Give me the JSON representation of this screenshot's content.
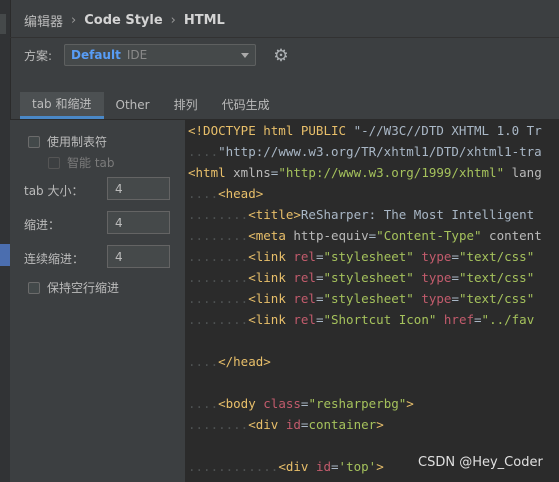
{
  "breadcrumb": {
    "item1": "编辑器",
    "item2": "Code Style",
    "item3": "HTML",
    "sep": "›"
  },
  "scheme": {
    "label": "方案:",
    "name": "Default",
    "tag": "IDE"
  },
  "tabs": [
    "tab 和缩进",
    "Other",
    "排列",
    "代码生成"
  ],
  "options": {
    "use_tab": "使用制表符",
    "smart_tab": "智能 tab",
    "tab_size_label": "tab 大小：",
    "tab_size": "4",
    "indent_label": "缩进：",
    "indent": "4",
    "continuation_label": "连续缩进：",
    "continuation": "4",
    "keep_indent": "保持空行缩进"
  },
  "code": {
    "l1": {
      "a": "<!DOCTYPE html PUBLIC ",
      "b": "\"-//W3C//DTD XHTML 1.0 Tr"
    },
    "l2": {
      "ws": "....",
      "a": "\"http://www.w3.org/TR/xhtml1/DTD/xhtml1-tra"
    },
    "l3": {
      "a": "<html ",
      "b": "xmlns",
      "c": "=",
      "d": "\"http://www.w3.org/1999/xhtml\"",
      "e": " lang"
    },
    "l4": {
      "ws": "....",
      "a": "<head>"
    },
    "l5": {
      "ws": "........",
      "a": "<title>",
      "b": "ReSharper: The Most Intelligent"
    },
    "l6": {
      "ws": "........",
      "a": "<meta ",
      "b": "http-equiv",
      "c": "=",
      "d": "\"Content-Type\"",
      "e": " content"
    },
    "l7": {
      "ws": "........",
      "a": "<link ",
      "b": "rel",
      "c": "=",
      "d": "\"stylesheet\"",
      "e": " type",
      "f": "=",
      "g": "\"text/css\""
    },
    "l8": {
      "ws": "........",
      "a": "<link ",
      "b": "rel",
      "c": "=",
      "d": "\"stylesheet\"",
      "e": " type",
      "f": "=",
      "g": "\"text/css\""
    },
    "l9": {
      "ws": "........",
      "a": "<link ",
      "b": "rel",
      "c": "=",
      "d": "\"stylesheet\"",
      "e": " type",
      "f": "=",
      "g": "\"text/css\""
    },
    "l10": {
      "ws": "........",
      "a": "<link ",
      "b": "rel",
      "c": "=",
      "d": "\"Shortcut Icon\"",
      "e": " href",
      "f": "=",
      "g": "\"../fav"
    },
    "l12": {
      "ws": "....",
      "a": "</head>"
    },
    "l14": {
      "ws": "....",
      "a": "<body ",
      "b": "class",
      "c": "=",
      "d": "\"resharperbg\"",
      "e": ">"
    },
    "l15": {
      "ws": "........",
      "a": "<div ",
      "b": "id",
      "c": "=",
      "d": "container",
      "e": ">"
    },
    "l17": {
      "ws": "............",
      "a": "<div ",
      "b": "id",
      "c": "=",
      "d": "'top'",
      "e": ">"
    }
  },
  "watermark": "CSDN @Hey_Coder"
}
